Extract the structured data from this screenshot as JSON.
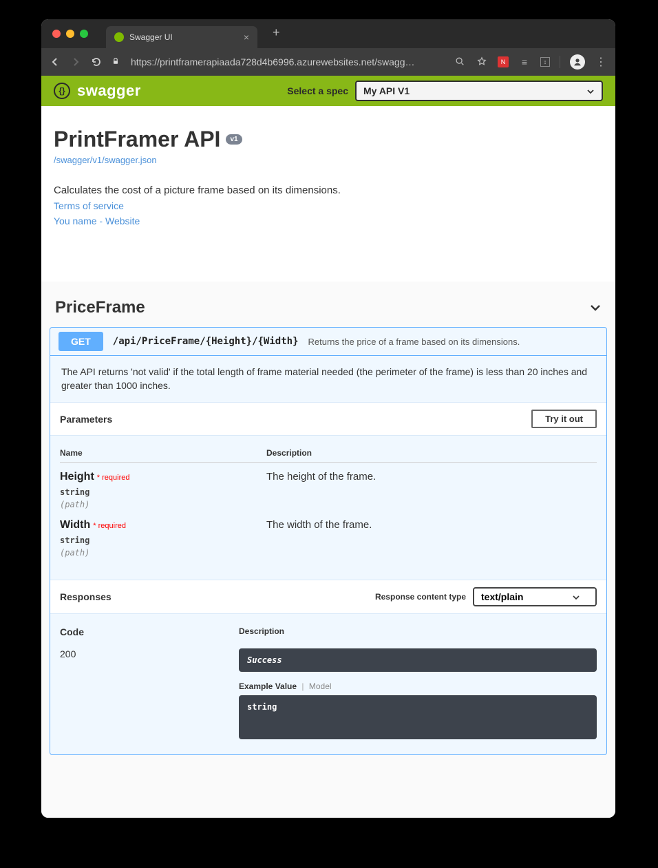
{
  "browser": {
    "tab_title": "Swagger UI",
    "url_display": "https://printframerapiaada728d4b6996.azurewebsites.net/swagg…"
  },
  "header": {
    "logo": "swagger",
    "spec_label": "Select a spec",
    "spec_value": "My API V1"
  },
  "api": {
    "title": "PrintFramer API",
    "version": "v1",
    "spec_url": "/swagger/v1/swagger.json",
    "description": "Calculates the cost of a picture frame based on its dimensions.",
    "terms": "Terms of service",
    "contact": "You name - Website"
  },
  "tag": {
    "name": "PriceFrame"
  },
  "op": {
    "method": "GET",
    "path": "/api/PriceFrame/{Height}/{Width}",
    "summary": "Returns the price of a frame based on its dimensions.",
    "note": "The API returns 'not valid' if the total length of frame material needed (the perimeter of the frame) is less than 20 inches and greater than 1000 inches.",
    "param_section": "Parameters",
    "try_label": "Try it out",
    "cols": {
      "name": "Name",
      "desc": "Description"
    },
    "params": [
      {
        "name": "Height",
        "req": "required",
        "type": "string",
        "loc": "(path)",
        "desc": "The height of the frame."
      },
      {
        "name": "Width",
        "req": "required",
        "type": "string",
        "loc": "(path)",
        "desc": "The width of the frame."
      }
    ],
    "resp_section": "Responses",
    "resp_content_label": "Response content type",
    "resp_content_value": "text/plain",
    "resp_cols": {
      "code": "Code",
      "desc": "Description"
    },
    "responses": [
      {
        "code": "200",
        "desc": "Success",
        "example_label": "Example Value",
        "model_label": "Model",
        "example": "string"
      }
    ]
  }
}
